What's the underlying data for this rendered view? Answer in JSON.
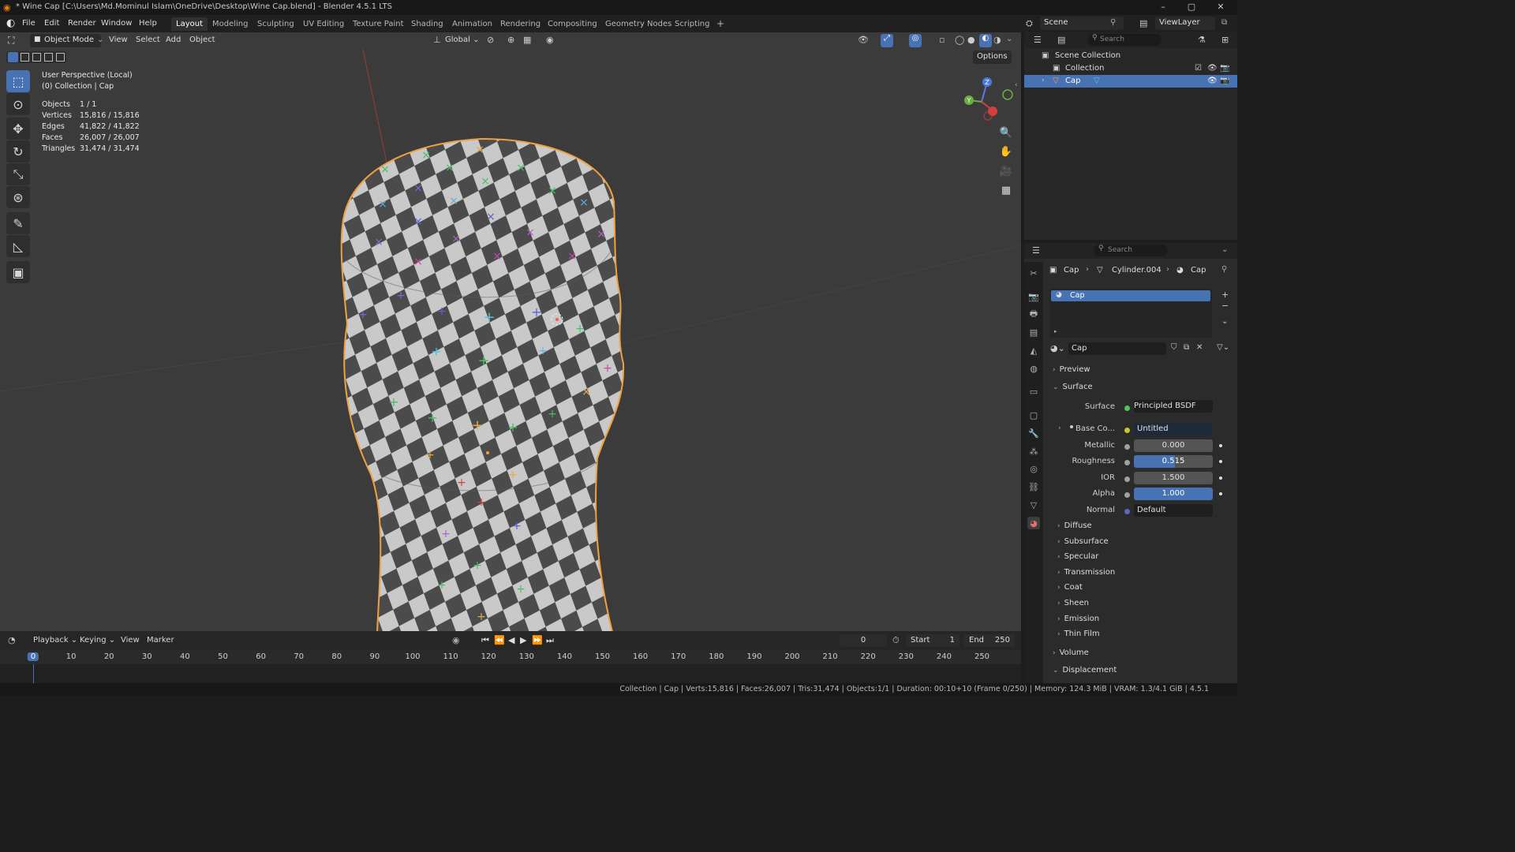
{
  "window": {
    "title": "* Wine Cap [C:\\Users\\Md.Mominul Islam\\OneDrive\\Desktop\\Wine Cap.blend] - Blender 4.5.1 LTS",
    "minimize": "–",
    "maximize": "▢",
    "close": "✕"
  },
  "menu": [
    "File",
    "Edit",
    "Render",
    "Window",
    "Help"
  ],
  "workspaces": [
    "Layout",
    "Modeling",
    "Sculpting",
    "UV Editing",
    "Texture Paint",
    "Shading",
    "Animation",
    "Rendering",
    "Compositing",
    "Geometry Nodes",
    "Scripting"
  ],
  "workspace_add": "+",
  "scene": {
    "label": "Scene",
    "view_layer": "ViewLayer"
  },
  "viewport": {
    "mode": "Object Mode",
    "menus": [
      "View",
      "Select",
      "Add",
      "Object"
    ],
    "orientation": "Global",
    "options": "Options",
    "info_title": "User Perspective (Local)",
    "info_sub": "(0) Collection | Cap",
    "stats": [
      {
        "label": "Objects",
        "value": "1 / 1"
      },
      {
        "label": "Vertices",
        "value": "15,816 / 15,816"
      },
      {
        "label": "Edges",
        "value": "41,822 / 41,822"
      },
      {
        "label": "Faces",
        "value": "26,007 / 26,007"
      },
      {
        "label": "Triangles",
        "value": "31,474 / 31,474"
      }
    ],
    "gizmo": {
      "z": "Z",
      "y": "Y"
    }
  },
  "tools": [
    "select-box",
    "cursor",
    "move",
    "rotate",
    "scale",
    "transform",
    "annotate",
    "measure",
    "add-cube"
  ],
  "outliner": {
    "search_placeholder": "Search",
    "rows": [
      {
        "label": "Scene Collection",
        "indent": 0
      },
      {
        "label": "Collection",
        "indent": 1
      },
      {
        "label": "Cap",
        "indent": 2,
        "selected": true
      }
    ]
  },
  "properties": {
    "search_placeholder": "Search",
    "breadcrumb": [
      "Cap",
      "Cylinder.004",
      "Cap"
    ],
    "material_slot": "Cap",
    "material_name": "Cap",
    "sections_top": [
      "Preview",
      "Surface"
    ],
    "surface_shader": "Principled BSDF",
    "fields": [
      {
        "label": "Surface",
        "value": "Principled BSDF",
        "kind": "text",
        "socket": "#4cc35d"
      },
      {
        "label": "Base Co...",
        "value": "Untitled",
        "kind": "text",
        "socket": "#c7c729"
      },
      {
        "label": "Metallic",
        "value": "0.000",
        "kind": "num",
        "socket": "#a1a1a1"
      },
      {
        "label": "Roughness",
        "value": "0.515",
        "kind": "partial",
        "fill": 0.515,
        "socket": "#a1a1a1"
      },
      {
        "label": "IOR",
        "value": "1.500",
        "kind": "num",
        "socket": "#a1a1a1"
      },
      {
        "label": "Alpha",
        "value": "1.000",
        "kind": "partial",
        "fill": 1.0,
        "socket": "#a1a1a1"
      },
      {
        "label": "Normal",
        "value": "Default",
        "kind": "text",
        "socket": "#6363c7"
      }
    ],
    "subsections": [
      "Diffuse",
      "Subsurface",
      "Specular",
      "Transmission",
      "Coat",
      "Sheen",
      "Emission",
      "Thin Film"
    ],
    "sections_bottom": [
      "Volume",
      "Displacement"
    ]
  },
  "timeline": {
    "menus": [
      "Playback",
      "Keying",
      "View",
      "Marker"
    ],
    "current_frame": "0",
    "start_label": "Start",
    "start": "1",
    "end_label": "End",
    "end": "250",
    "ticks": [
      "0",
      "10",
      "20",
      "30",
      "40",
      "50",
      "60",
      "70",
      "80",
      "90",
      "100",
      "110",
      "120",
      "130",
      "140",
      "150",
      "160",
      "170",
      "180",
      "190",
      "200",
      "210",
      "220",
      "230",
      "240",
      "250"
    ]
  },
  "status": "Collection | Cap | Verts:15,816 | Faces:26,007 | Tris:31,474 | Objects:1/1 | Duration: 00:10+10 (Frame 0/250) | Memory: 124.3 MiB | VRAM: 1.3/4.1 GiB | 4.5.1",
  "colors": {
    "accent": "#4772b3",
    "selection_outline": "#f0a040"
  }
}
